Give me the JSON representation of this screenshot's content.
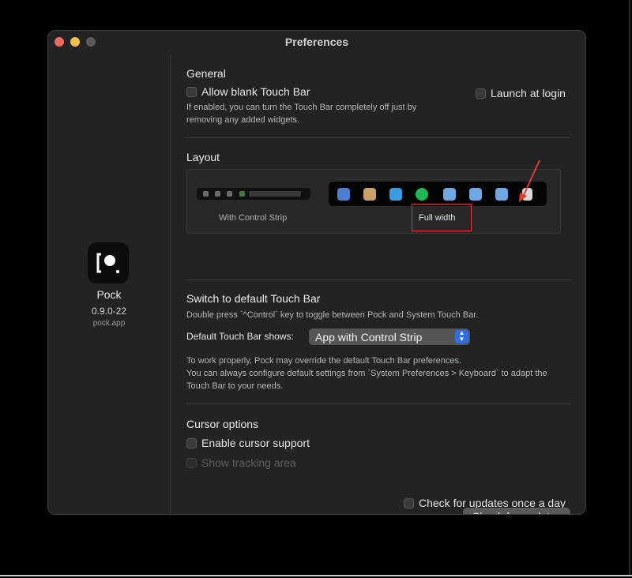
{
  "window": {
    "title": "Preferences"
  },
  "sidebar": {
    "app_name": "Pock",
    "version": "0.9.0-22",
    "website": "pock.app"
  },
  "general": {
    "heading": "General",
    "allow_blank_label": "Allow blank Touch Bar",
    "allow_blank_checked": false,
    "launch_login_label": "Launch at login",
    "launch_login_checked": false,
    "description_line1": "If enabled, you can turn the Touch Bar completely off just by",
    "description_line2": "removing any added widgets."
  },
  "layout": {
    "heading": "Layout",
    "options": [
      {
        "label": "With Control Strip"
      },
      {
        "label": "Full width"
      }
    ],
    "selected": "Full width"
  },
  "switch_default": {
    "heading": "Switch to default Touch Bar",
    "hint": "Double press `^Control` key to toggle between Pock and System Touch Bar.",
    "default_label": "Default Touch Bar shows:",
    "default_value": "App with Control Strip",
    "note_line1": "To work properly, Pock may override the default Touch Bar preferences.",
    "note_line2": "You can always configure default settings from `System Preferences > Keyboard` to adapt the",
    "note_line3": "Touch Bar to your needs."
  },
  "cursor": {
    "heading": "Cursor options",
    "enable_label": "Enable cursor support",
    "enable_checked": false,
    "show_area_label": "Show tracking area",
    "show_area_checked": false
  },
  "updates": {
    "daily_label": "Check for updates once a day",
    "daily_checked": false,
    "button_label": "Check for updates"
  },
  "colors": {
    "window_bg": "#232323",
    "accent": "#2f6fe0",
    "annotation": "#e23a2c"
  }
}
